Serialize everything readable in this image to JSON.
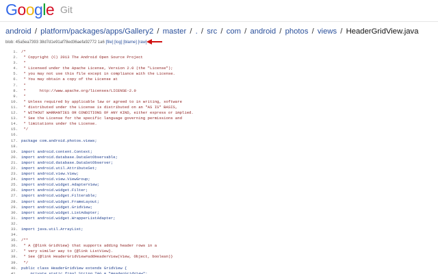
{
  "header": {
    "logo_text": "Google",
    "logo_letter_colors": [
      "#3369e8",
      "#d50f25",
      "#eeb211",
      "#3369e8",
      "#009925",
      "#d50f25"
    ],
    "product": "Git"
  },
  "breadcrumb": {
    "items": [
      "android",
      "platform/packages/apps/Gallery2",
      "master",
      ".",
      "src",
      "com",
      "android",
      "photos",
      "views"
    ],
    "separator": "/",
    "current": "HeaderGridView.java"
  },
  "blob": {
    "prefix": "blob: 45a5ea7393 38d7d1e91af78ed36aefa92772 1a6",
    "links": [
      "[file]",
      "[log]",
      "[blame]",
      "[raw]"
    ]
  },
  "arrow_color": "#d01010",
  "code": [
    {
      "n": "1.",
      "t": "/*",
      "k": "comment"
    },
    {
      "n": "2.",
      "t": " * Copyright (C) 2013 The Android Open Source Project",
      "k": "comment"
    },
    {
      "n": "3.",
      "t": " *",
      "k": "comment"
    },
    {
      "n": "4.",
      "t": " * Licensed under the Apache License, Version 2.0 (the \"License\");",
      "k": "comment"
    },
    {
      "n": "5.",
      "t": " * you may not use this file except in compliance with the License.",
      "k": "comment"
    },
    {
      "n": "6.",
      "t": " * You may obtain a copy of the License at",
      "k": "comment"
    },
    {
      "n": "7.",
      "t": " *",
      "k": "comment"
    },
    {
      "n": "8.",
      "t": " *      http://www.apache.org/licenses/LICENSE-2.0",
      "k": "comment"
    },
    {
      "n": "9.",
      "t": " *",
      "k": "comment"
    },
    {
      "n": "10.",
      "t": " * Unless required by applicable law or agreed to in writing, software",
      "k": "comment"
    },
    {
      "n": "11.",
      "t": " * distributed under the License is distributed on an \"AS IS\" BASIS,",
      "k": "comment"
    },
    {
      "n": "12.",
      "t": " * WITHOUT WARRANTIES OR CONDITIONS OF ANY KIND, either express or implied.",
      "k": "comment"
    },
    {
      "n": "13.",
      "t": " * See the License for the specific language governing permissions and",
      "k": "comment"
    },
    {
      "n": "14.",
      "t": " * limitations under the License.",
      "k": "comment"
    },
    {
      "n": "15.",
      "t": " */",
      "k": "comment"
    },
    {
      "n": "16.",
      "t": "",
      "k": "plain"
    },
    {
      "n": "17.",
      "t": "package com.android.photos.views;",
      "k": "kw"
    },
    {
      "n": "18.",
      "t": "",
      "k": "plain"
    },
    {
      "n": "19.",
      "t": "import android.content.Context;",
      "k": "kw"
    },
    {
      "n": "20.",
      "t": "import android.database.DataSetObservable;",
      "k": "kw"
    },
    {
      "n": "21.",
      "t": "import android.database.DataSetObserver;",
      "k": "kw"
    },
    {
      "n": "22.",
      "t": "import android.util.AttributeSet;",
      "k": "kw"
    },
    {
      "n": "23.",
      "t": "import android.view.View;",
      "k": "kw"
    },
    {
      "n": "24.",
      "t": "import android.view.ViewGroup;",
      "k": "kw"
    },
    {
      "n": "25.",
      "t": "import android.widget.AdapterView;",
      "k": "kw"
    },
    {
      "n": "26.",
      "t": "import android.widget.Filter;",
      "k": "kw"
    },
    {
      "n": "27.",
      "t": "import android.widget.Filterable;",
      "k": "kw"
    },
    {
      "n": "28.",
      "t": "import android.widget.FrameLayout;",
      "k": "kw"
    },
    {
      "n": "29.",
      "t": "import android.widget.GridView;",
      "k": "kw"
    },
    {
      "n": "30.",
      "t": "import android.widget.ListAdapter;",
      "k": "kw"
    },
    {
      "n": "31.",
      "t": "import android.widget.WrapperListAdapter;",
      "k": "kw"
    },
    {
      "n": "32.",
      "t": "",
      "k": "plain"
    },
    {
      "n": "33.",
      "t": "import java.util.ArrayList;",
      "k": "kw"
    },
    {
      "n": "34.",
      "t": "",
      "k": "plain"
    },
    {
      "n": "35.",
      "t": "/**",
      "k": "comment"
    },
    {
      "n": "36.",
      "t": " * A {@link GridView} that supports adding header rows in a",
      "k": "comment"
    },
    {
      "n": "37.",
      "t": " * very similar way to {@link ListView}.",
      "k": "comment"
    },
    {
      "n": "38.",
      "t": " * See {@link HeaderGridView#addHeaderView(View, Object, boolean)}",
      "k": "comment"
    },
    {
      "n": "39.",
      "t": " */",
      "k": "comment"
    },
    {
      "n": "40.",
      "t": "public class HeaderGridView extends GridView {",
      "k": "kw"
    },
    {
      "n": "41.",
      "t": "    private static final String TAG = \"HeaderGridView\";",
      "k": "kw"
    }
  ]
}
